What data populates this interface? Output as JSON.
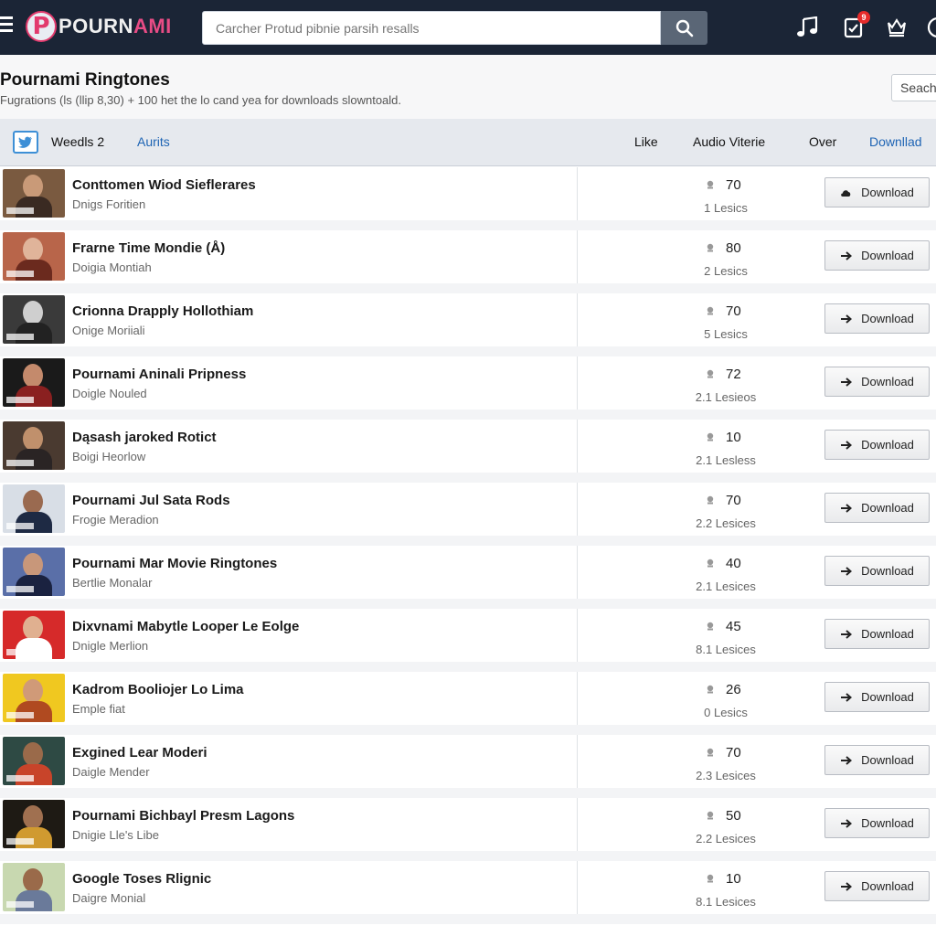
{
  "header": {
    "logo_letter": "P",
    "logo_text_main": "POURN",
    "logo_text_accent": "AMI",
    "search_placeholder": "Carcher Protud pibnie parsih resalls",
    "notification_count": "9"
  },
  "page": {
    "title": "Pournami Ringtones",
    "subtitle": "Fugrations (ls (llip 8,30) + 100 het the lo cand yea for downloads slowntoald.",
    "search_button": "Seach"
  },
  "table_header": {
    "col1": "Weedls 2",
    "col2": "Aurits",
    "like": "Like",
    "audio": "Audio Viterie",
    "over": "Over",
    "download": "Downllad"
  },
  "rows": [
    {
      "title": "Conttomen Wiod Sieflerares",
      "artist": "Dnigs Foritien",
      "likes": "70",
      "plays": "1 Lesics",
      "button": "Download",
      "icon": "cloud-download-icon",
      "thumb_bg": "#7a5a40",
      "skin": "#c99a78",
      "cloth": "#3a2a22"
    },
    {
      "title": "Frarne Time Mondie (Å)",
      "artist": "Doigia Montiah",
      "likes": "80",
      "plays": "2 Lesics",
      "button": "Download",
      "icon": "arrow-right-icon",
      "thumb_bg": "#b8654a",
      "skin": "#e0b49a",
      "cloth": "#6b2a1e"
    },
    {
      "title": "Crionna Drapply Hollothiam",
      "artist": "Onige Moriiali",
      "likes": "70",
      "plays": "5 Lesics",
      "button": "Download",
      "icon": "arrow-right-icon",
      "thumb_bg": "#3a3a3a",
      "skin": "#cfcfcf",
      "cloth": "#222222"
    },
    {
      "title": "Pournami Aninali Pripness",
      "artist": "Doigle Nouled",
      "likes": "72",
      "plays": "2.1 Lesieos",
      "button": "Download",
      "icon": "arrow-right-icon",
      "thumb_bg": "#1a1a1a",
      "skin": "#c48a6c",
      "cloth": "#8a2020"
    },
    {
      "title": "Dąsash jaroked Rotict",
      "artist": "Boigi Heorlow",
      "likes": "10",
      "plays": "2.1 Lesless",
      "button": "Download",
      "icon": "arrow-right-icon",
      "thumb_bg": "#4a3a30",
      "skin": "#c0906c",
      "cloth": "#2a2424"
    },
    {
      "title": "Pournami Jul Sata Rods",
      "artist": "Frogie Meradion",
      "likes": "70",
      "plays": "2.2 Lesices",
      "button": "Download",
      "icon": "arrow-right-icon",
      "thumb_bg": "#d8dee6",
      "skin": "#9a6a50",
      "cloth": "#1e2a44"
    },
    {
      "title": "Pournami Mar Movie Ringtones",
      "artist": "Bertlie Monalar",
      "likes": "40",
      "plays": "2.1 Lesices",
      "button": "Download",
      "icon": "arrow-right-icon",
      "thumb_bg": "#5a6fa8",
      "skin": "#c8977a",
      "cloth": "#1a2240"
    },
    {
      "title": "Dixvnami Mabytle Looper Le Eolge",
      "artist": "Dnigle Merlion",
      "likes": "45",
      "plays": "8.1 Lesices",
      "button": "Download",
      "icon": "arrow-right-icon",
      "thumb_bg": "#d62a2a",
      "skin": "#e0b090",
      "cloth": "#ffffff"
    },
    {
      "title": "Kadrom Booliojer Lo Lima",
      "artist": "Emple fiat",
      "likes": "26",
      "plays": "0 Lesics",
      "button": "Download",
      "icon": "arrow-right-icon",
      "thumb_bg": "#f0c820",
      "skin": "#d09a78",
      "cloth": "#b04a20"
    },
    {
      "title": "Exgined Lear Moderi",
      "artist": "Daigle Mender",
      "likes": "70",
      "plays": "2.3 Lesices",
      "button": "Download",
      "icon": "arrow-right-icon",
      "thumb_bg": "#2e4a44",
      "skin": "#9a6a4a",
      "cloth": "#c8442a"
    },
    {
      "title": "Pournami Bichbayl Presm Lagons",
      "artist": "Dnigie Lle's Libe",
      "likes": "50",
      "plays": "2.2 Lesices",
      "button": "Download",
      "icon": "arrow-right-icon",
      "thumb_bg": "#1e1a14",
      "skin": "#a07050",
      "cloth": "#d09a30"
    },
    {
      "title": "Google Toses Rlignic",
      "artist": "Daigre Monial",
      "likes": "10",
      "plays": "8.1 Lesices",
      "button": "Download",
      "icon": "arrow-right-icon",
      "thumb_bg": "#c8d8b0",
      "skin": "#9a6a4a",
      "cloth": "#6a7a9a"
    }
  ]
}
